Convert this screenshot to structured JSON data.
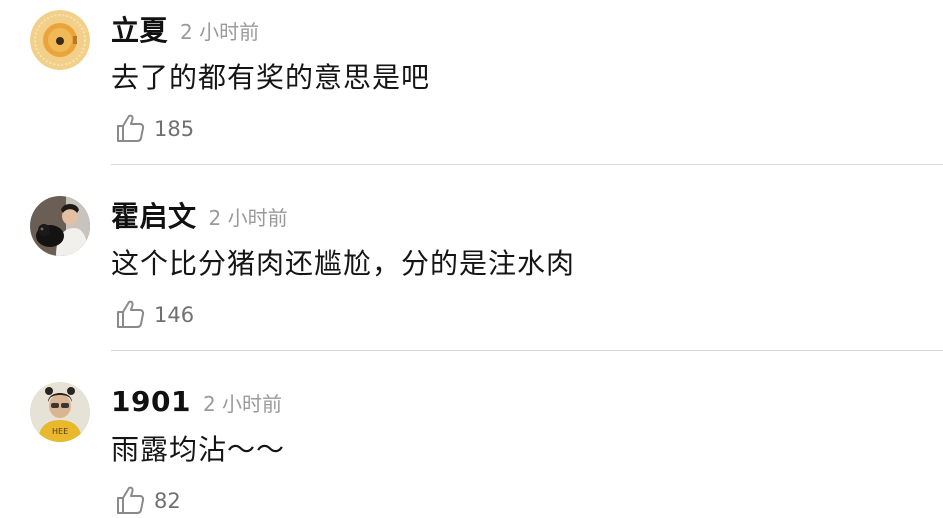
{
  "comments": [
    {
      "username": "立夏",
      "time": "2 小时前",
      "text": "去了的都有奖的意思是吧",
      "likes": "185",
      "avatar_icon": "orange-sun-avatar-icon"
    },
    {
      "username": "霍启文",
      "time": "2 小时前",
      "text": "这个比分猪肉还尴尬，分的是注水肉",
      "likes": "146",
      "avatar_icon": "person-with-dog-avatar-icon"
    },
    {
      "username": "1901",
      "time": "2 小时前",
      "text": "雨露均沾～～",
      "likes": "82",
      "avatar_icon": "person-yellow-shirt-avatar-icon"
    }
  ],
  "colors": {
    "timestamp": "#9a9a9a",
    "like_count": "#707070",
    "divider": "#d9d9d9"
  }
}
